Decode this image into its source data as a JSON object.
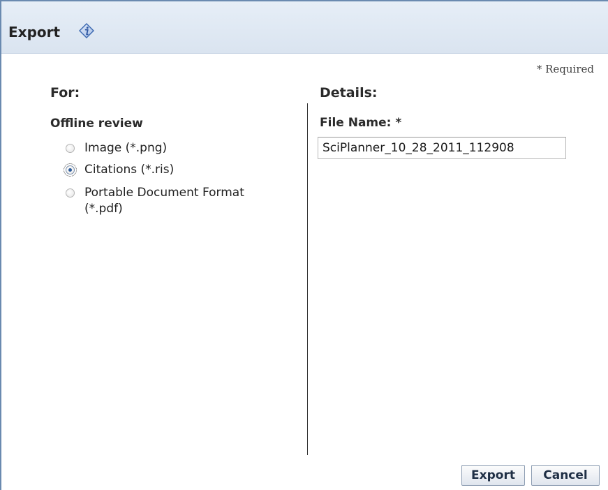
{
  "dialog": {
    "title": "Export",
    "required_note": "* Required"
  },
  "for_section": {
    "heading": "For:",
    "group_label": "Offline review",
    "options": [
      {
        "label": "Image (*.png)",
        "checked": false
      },
      {
        "label": "Citations (*.ris)",
        "checked": true
      },
      {
        "label": "Portable Document Format (*.pdf)",
        "checked": false
      }
    ]
  },
  "details_section": {
    "heading": "Details:",
    "file_name_label": "File Name: *",
    "file_name_value": "SciPlanner_10_28_2011_112908"
  },
  "buttons": {
    "export_label": "Export",
    "cancel_label": "Cancel"
  },
  "icons": {
    "title_icon": "info-icon"
  },
  "colors": {
    "titlebar": "#dae4f0",
    "border": "#6a8ab0",
    "icon_blue": "#3b68b0"
  }
}
